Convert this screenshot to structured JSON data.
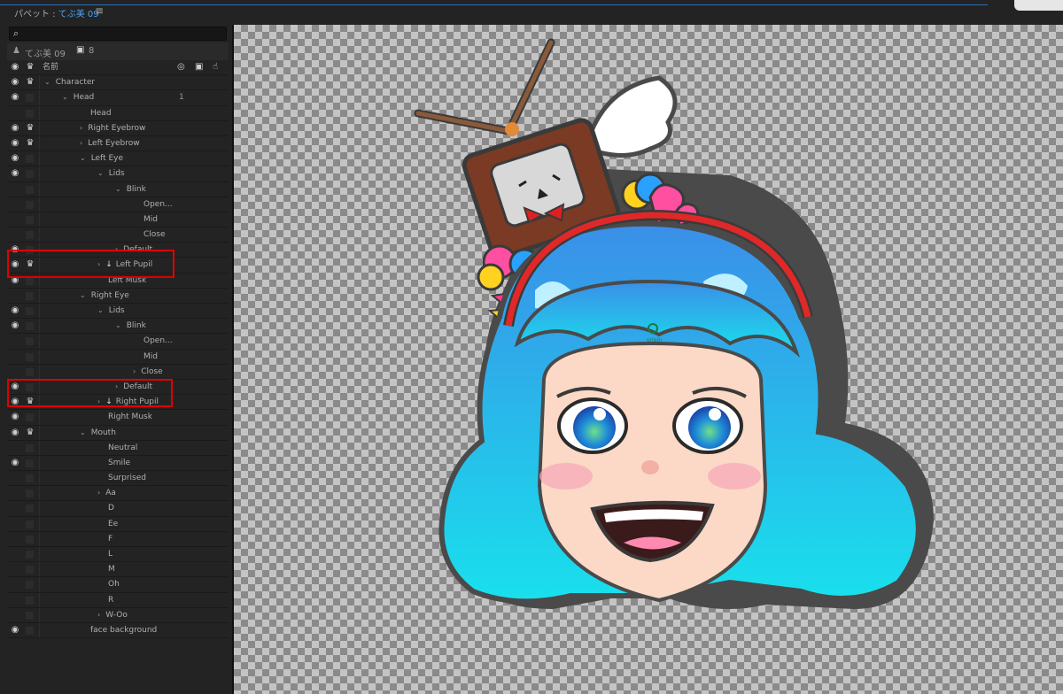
{
  "window": {
    "title_prefix": "パペット : ",
    "puppet_name": "てぶ美 09",
    "menu_icon": "≡"
  },
  "search": {
    "icon": "magnifier-icon",
    "value": ""
  },
  "puppet": {
    "name": "てぶ美 09",
    "camera_count": "8"
  },
  "header": {
    "name_label": "名前"
  },
  "layers": [
    {
      "label": "Character",
      "indent": 0,
      "chevron": "down",
      "eye": true,
      "crown": true
    },
    {
      "label": "Head",
      "indent": 1,
      "chevron": "down",
      "eye": true,
      "crown": false,
      "number": "1"
    },
    {
      "label": "Head",
      "indent": 2,
      "chevron": "",
      "eye": false,
      "crown": false
    },
    {
      "label": "Right Eyebrow",
      "indent": 2,
      "chevron": "right",
      "eye": true,
      "crown": true
    },
    {
      "label": "Left Eyebrow",
      "indent": 2,
      "chevron": "right",
      "eye": true,
      "crown": true
    },
    {
      "label": "Left Eye",
      "indent": 2,
      "chevron": "down",
      "eye": true,
      "crown": false
    },
    {
      "label": "Lids",
      "indent": 3,
      "chevron": "down",
      "eye": true,
      "crown": false
    },
    {
      "label": "Blink",
      "indent": 4,
      "chevron": "down",
      "eye": false,
      "crown": false
    },
    {
      "label": "Open...",
      "indent": 5,
      "chevron": "",
      "eye": false,
      "crown": false
    },
    {
      "label": "Mid",
      "indent": 5,
      "chevron": "",
      "eye": false,
      "crown": false
    },
    {
      "label": "Close",
      "indent": 5,
      "chevron": "",
      "eye": false,
      "crown": false
    },
    {
      "label": "Default",
      "indent": 4,
      "chevron": "right",
      "eye": true,
      "crown": false
    },
    {
      "label": "Left Pupil",
      "indent": 3,
      "chevron": "right",
      "eye": true,
      "crown": true,
      "pin": true
    },
    {
      "label": "Left Musk",
      "indent": 3,
      "chevron": "",
      "eye": true,
      "crown": false
    },
    {
      "label": "Right Eye",
      "indent": 2,
      "chevron": "down",
      "eye": false,
      "crown": false
    },
    {
      "label": "Lids",
      "indent": 3,
      "chevron": "down",
      "eye": true,
      "crown": false
    },
    {
      "label": "Blink",
      "indent": 4,
      "chevron": "down",
      "eye": true,
      "crown": false
    },
    {
      "label": "Open...",
      "indent": 5,
      "chevron": "",
      "eye": false,
      "crown": false
    },
    {
      "label": "Mid",
      "indent": 5,
      "chevron": "",
      "eye": false,
      "crown": false
    },
    {
      "label": "Close",
      "indent": 5,
      "chevron": "right",
      "eye": false,
      "crown": false
    },
    {
      "label": "Default",
      "indent": 4,
      "chevron": "right",
      "eye": true,
      "crown": false
    },
    {
      "label": "Right Pupil",
      "indent": 3,
      "chevron": "right",
      "eye": true,
      "crown": true,
      "pin": true
    },
    {
      "label": "Right Musk",
      "indent": 3,
      "chevron": "",
      "eye": true,
      "crown": false
    },
    {
      "label": "Mouth",
      "indent": 2,
      "chevron": "down",
      "eye": true,
      "crown": true
    },
    {
      "label": "Neutral",
      "indent": 3,
      "chevron": "",
      "eye": false,
      "crown": false
    },
    {
      "label": "Smile",
      "indent": 3,
      "chevron": "",
      "eye": true,
      "crown": false
    },
    {
      "label": "Surprised",
      "indent": 3,
      "chevron": "",
      "eye": false,
      "crown": false
    },
    {
      "label": "Aa",
      "indent": 3,
      "chevron": "right",
      "eye": false,
      "crown": false
    },
    {
      "label": "D",
      "indent": 3,
      "chevron": "",
      "eye": false,
      "crown": false
    },
    {
      "label": "Ee",
      "indent": 3,
      "chevron": "",
      "eye": false,
      "crown": false
    },
    {
      "label": "F",
      "indent": 3,
      "chevron": "",
      "eye": false,
      "crown": false
    },
    {
      "label": "L",
      "indent": 3,
      "chevron": "",
      "eye": false,
      "crown": false
    },
    {
      "label": "M",
      "indent": 3,
      "chevron": "",
      "eye": false,
      "crown": false
    },
    {
      "label": "Oh",
      "indent": 3,
      "chevron": "",
      "eye": false,
      "crown": false
    },
    {
      "label": "R",
      "indent": 3,
      "chevron": "",
      "eye": false,
      "crown": false
    },
    {
      "label": "W-Oo",
      "indent": 3,
      "chevron": "right",
      "eye": false,
      "crown": false
    },
    {
      "label": "face background",
      "indent": 2,
      "chevron": "",
      "eye": true,
      "crown": false
    }
  ],
  "canvas": {
    "origin_label": "origin"
  },
  "colors": {
    "hair_top": "#3a8fe8",
    "hair_bottom": "#19e0ec",
    "skin": "#fbd9c6",
    "highlight_box": "#e00000",
    "accent_blue": "#4aa3ff"
  }
}
